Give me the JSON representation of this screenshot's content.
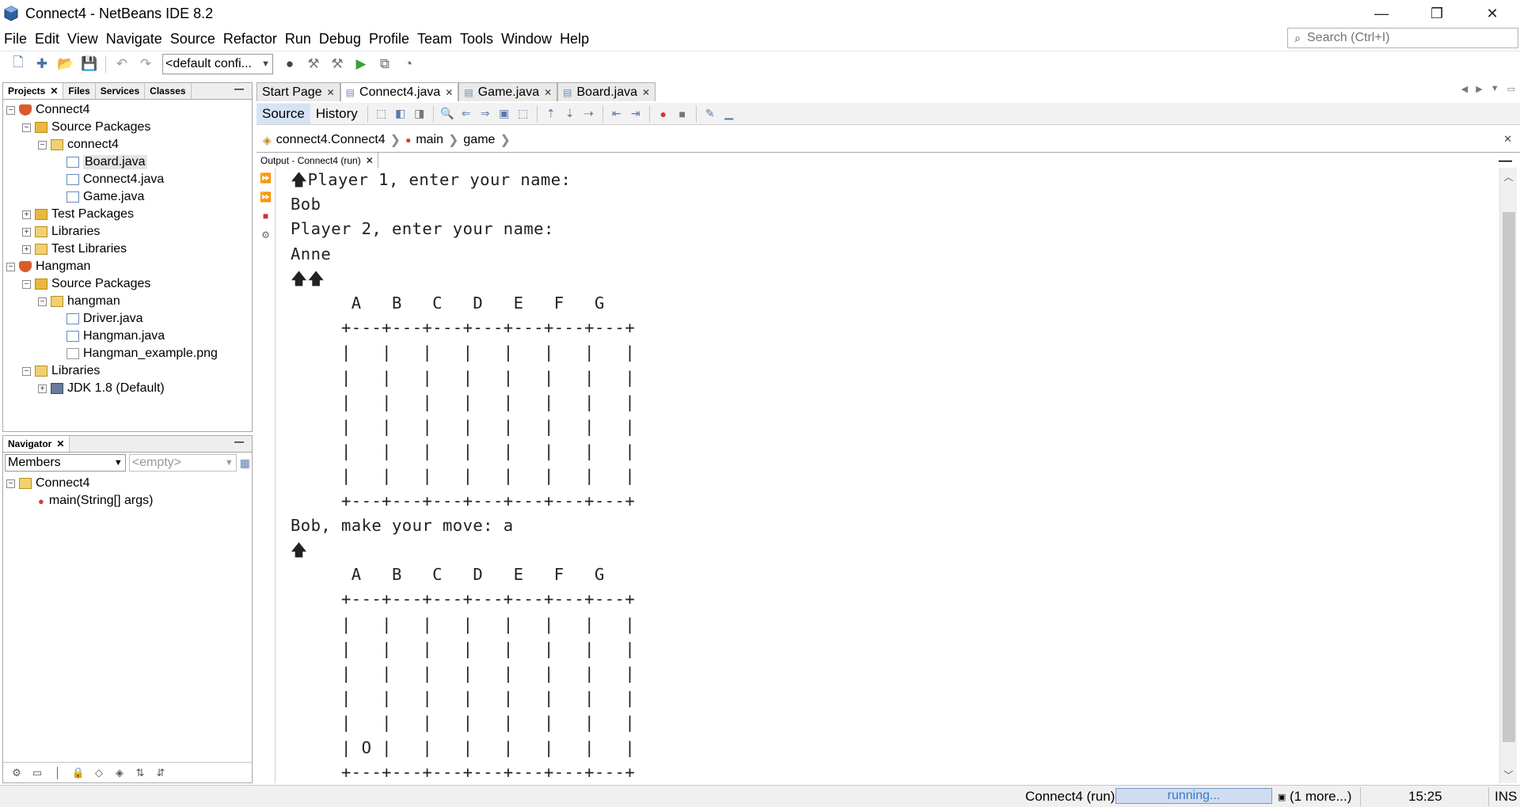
{
  "window": {
    "title": "Connect4 - NetBeans IDE 8.2",
    "controls": [
      "—",
      "❐",
      "✕"
    ]
  },
  "menu": [
    "File",
    "Edit",
    "View",
    "Navigate",
    "Source",
    "Refactor",
    "Run",
    "Debug",
    "Profile",
    "Team",
    "Tools",
    "Window",
    "Help"
  ],
  "search": {
    "placeholder": "Search (Ctrl+I)"
  },
  "toolbar": {
    "config": "<default confi..."
  },
  "projects_panel": {
    "tabs": [
      "Projects",
      "Files",
      "Services",
      "Classes"
    ],
    "tree": [
      {
        "label": "Connect4",
        "icon": "project-icon"
      },
      {
        "label": "Source Packages",
        "icon": "source-packages-icon"
      },
      {
        "label": "connect4",
        "icon": "package-icon"
      },
      {
        "label": "Board.java",
        "icon": "java-file-icon"
      },
      {
        "label": "Connect4.java",
        "icon": "java-file-icon"
      },
      {
        "label": "Game.java",
        "icon": "java-file-icon"
      },
      {
        "label": "Test Packages",
        "icon": "test-packages-icon"
      },
      {
        "label": "Libraries",
        "icon": "libraries-icon"
      },
      {
        "label": "Test Libraries",
        "icon": "test-libraries-icon"
      },
      {
        "label": "Hangman",
        "icon": "project-icon"
      },
      {
        "label": "Source Packages",
        "icon": "source-packages-icon"
      },
      {
        "label": "hangman",
        "icon": "package-icon"
      },
      {
        "label": "Driver.java",
        "icon": "java-file-icon"
      },
      {
        "label": "Hangman.java",
        "icon": "java-file-icon"
      },
      {
        "label": "Hangman_example.png",
        "icon": "image-file-icon"
      },
      {
        "label": "Libraries",
        "icon": "libraries-icon"
      },
      {
        "label": "JDK 1.8 (Default)",
        "icon": "jdk-icon"
      }
    ]
  },
  "navigator": {
    "tab": "Navigator",
    "members_select": "Members",
    "filter_select": "<empty>",
    "tree": [
      {
        "label": "Connect4",
        "icon": "class-icon"
      },
      {
        "label": "main(String[] args)",
        "icon": "method-icon"
      }
    ]
  },
  "editor": {
    "tabs": [
      {
        "label": "Start Page",
        "active": false
      },
      {
        "label": "Connect4.java",
        "active": true
      },
      {
        "label": "Game.java",
        "active": false
      },
      {
        "label": "Board.java",
        "active": false
      }
    ],
    "modes": [
      "Source",
      "History"
    ],
    "breadcrumb": [
      "connect4.Connect4",
      "main",
      "game"
    ]
  },
  "output": {
    "tab_label": "Output - Connect4 (run)",
    "lines": [
      "🡅Player 1, enter your name:",
      "Bob",
      "Player 2, enter your name:",
      "Anne",
      "🡅🡅",
      "      A   B   C   D   E   F   G",
      "     +---+---+---+---+---+---+---+",
      "     |   |   |   |   |   |   |   |",
      "     |   |   |   |   |   |   |   |",
      "     |   |   |   |   |   |   |   |",
      "     |   |   |   |   |   |   |   |",
      "     |   |   |   |   |   |   |   |",
      "     |   |   |   |   |   |   |   |",
      "     +---+---+---+---+---+---+---+",
      "Bob, make your move: a",
      "🡅",
      "      A   B   C   D   E   F   G",
      "     +---+---+---+---+---+---+---+",
      "     |   |   |   |   |   |   |   |",
      "     |   |   |   |   |   |   |   |",
      "     |   |   |   |   |   |   |   |",
      "     |   |   |   |   |   |   |   |",
      "     |   |   |   |   |   |   |   |",
      "     | O |   |   |   |   |   |   |",
      "     +---+---+---+---+---+---+---+"
    ]
  },
  "status": {
    "run_label": "Connect4 (run)",
    "progress_text": "running...",
    "more": "(1 more...)",
    "position": "15:25",
    "mode": "INS"
  }
}
